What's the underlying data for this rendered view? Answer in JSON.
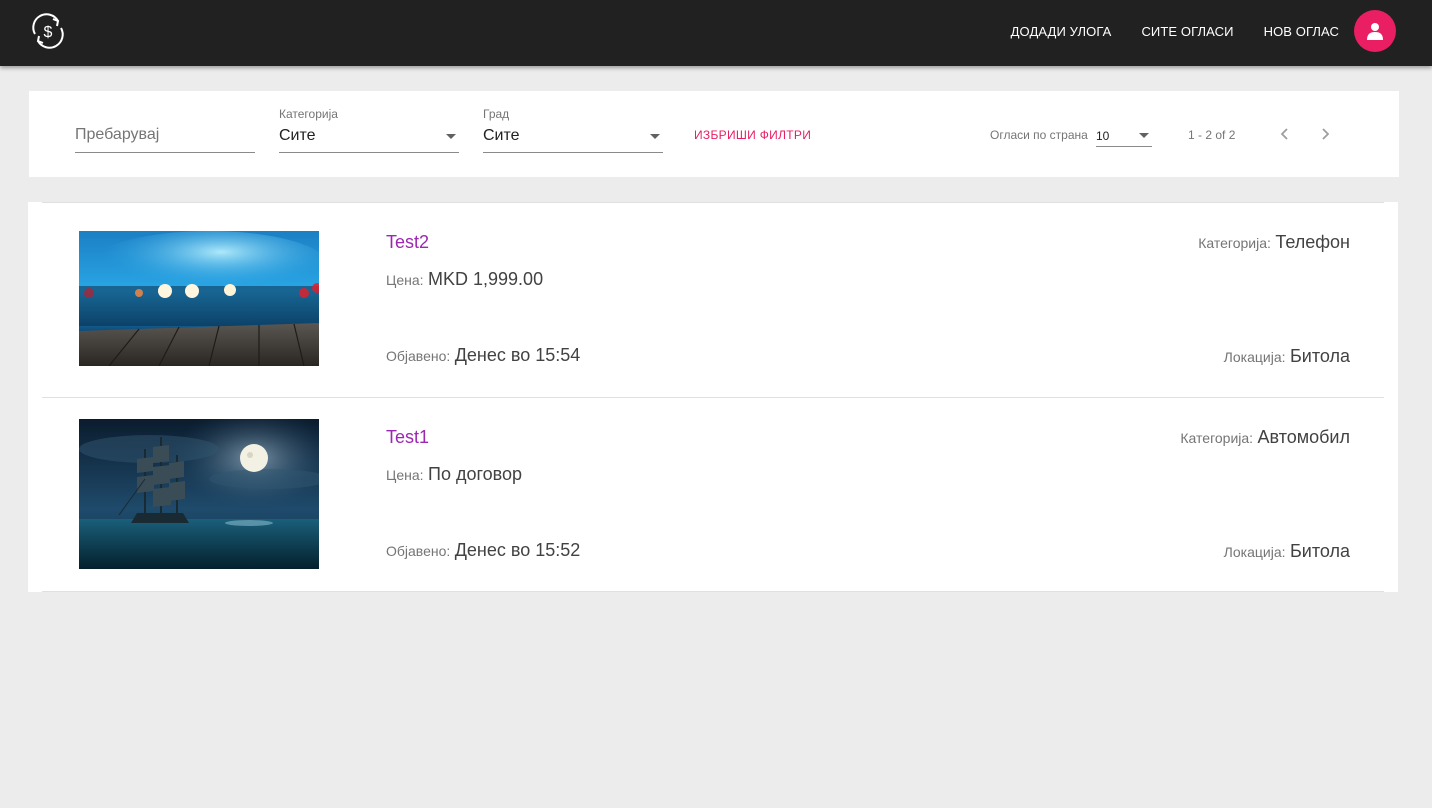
{
  "nav": {
    "logo_icon": "dollar-exchange-icon",
    "links": [
      "ДОДАДИ УЛОГА",
      "СИТЕ ОГЛАСИ",
      "НОВ ОГЛАС"
    ],
    "avatar_icon": "user-icon",
    "accent": "#e91e63",
    "bar_color": "#212121"
  },
  "filters": {
    "search_placeholder": "Пребарувај",
    "search_value": "",
    "category": {
      "label": "Категорија",
      "value": "Сите"
    },
    "city": {
      "label": "Град",
      "value": "Сите"
    },
    "clear_label": "ИЗБРИШИ ФИЛТРИ",
    "per_page": {
      "label": "Огласи по страна",
      "value": "10"
    },
    "range": "1 - 2 of 2",
    "prev_icon": "chevron-left-icon",
    "next_icon": "chevron-right-icon"
  },
  "listings": [
    {
      "title": "Test2",
      "price_label": "Цена:",
      "price": "MKD 1,999.00",
      "posted_label": "Објавено:",
      "posted": "Денес во 15:54",
      "category_label": "Категорија:",
      "category": "Телефон",
      "location_label": "Локација:",
      "location": "Битола",
      "image": "bokeh-lights-wooden-deck-photo"
    },
    {
      "title": "Test1",
      "price_label": "Цена:",
      "price": "По договор",
      "posted_label": "Објавено:",
      "posted": "Денес во 15:52",
      "category_label": "Категорија:",
      "category": "Автомобил",
      "location_label": "Локација:",
      "location": "Битола",
      "image": "pirate-ship-moon-photo"
    }
  ],
  "colors": {
    "title": "#9c27b0",
    "background": "#ececec"
  }
}
